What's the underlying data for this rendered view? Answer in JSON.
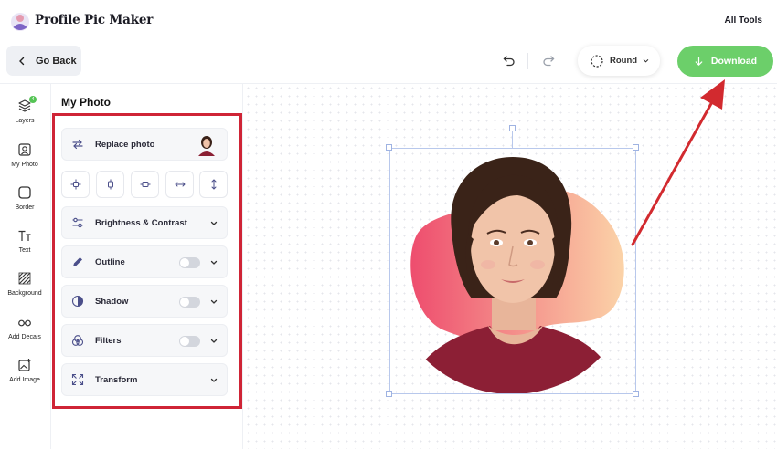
{
  "app": {
    "title": "Profile Pic Maker",
    "all_tools": "All Tools"
  },
  "toolbar": {
    "go_back": "Go Back",
    "undo_icon": "undo-icon",
    "redo_icon": "redo-icon",
    "shape_label": "Round",
    "download_label": "Download",
    "download_color": "#6ccf6a"
  },
  "rail": {
    "items": [
      {
        "label": "Layers",
        "icon": "layers-icon",
        "badge": "4"
      },
      {
        "label": "My Photo",
        "icon": "photo-icon"
      },
      {
        "label": "Border",
        "icon": "border-icon"
      },
      {
        "label": "Text",
        "icon": "text-icon"
      },
      {
        "label": "Background",
        "icon": "background-icon"
      },
      {
        "label": "Add Decals",
        "icon": "glasses-icon"
      },
      {
        "label": "Add Image",
        "icon": "add-image-icon"
      }
    ]
  },
  "panel": {
    "title": "My Photo",
    "replace_photo": "Replace photo",
    "align_icons": [
      "align-center-icon",
      "align-vertical-icon",
      "align-horizontal-icon",
      "flip-horizontal-icon",
      "flip-vertical-icon"
    ],
    "brightness": "Brightness & Contrast",
    "outline": "Outline",
    "outline_on": false,
    "shadow": "Shadow",
    "shadow_on": false,
    "filters": "Filters",
    "filters_on": false,
    "transform": "Transform"
  },
  "colors": {
    "highlight": "#cf2436",
    "arrow": "#d22a2f",
    "blob_start": "#ee4d6e",
    "blob_end": "#fbd3a8"
  }
}
